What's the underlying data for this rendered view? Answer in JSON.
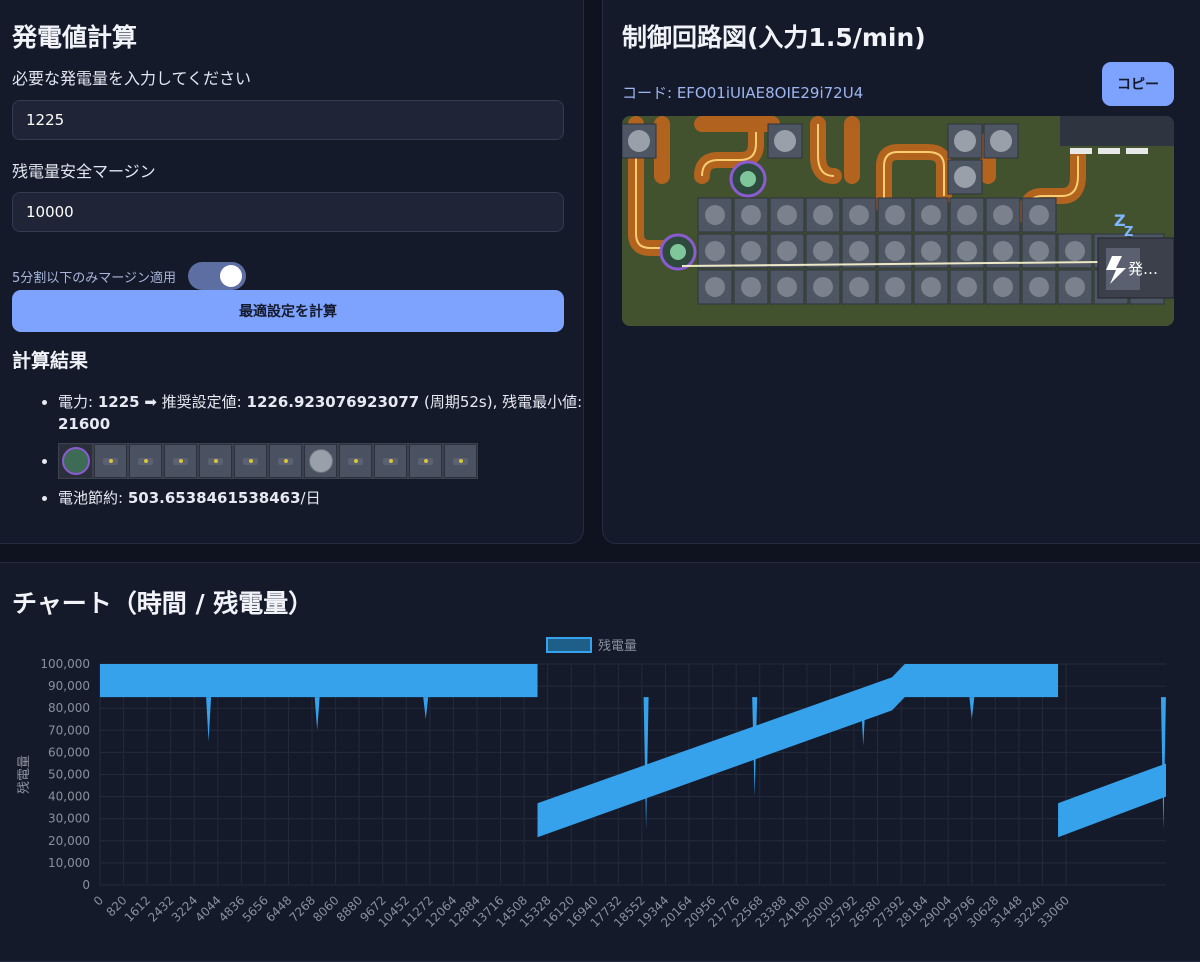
{
  "calc": {
    "title": "発電値計算",
    "power_label": "必要な発電量を入力してください",
    "power_value": "1225",
    "margin_label": "残電量安全マージン",
    "margin_value": "10000",
    "toggle_label": "5分割以下のみマージン適用",
    "toggle_on": true,
    "calc_button": "最適設定を計算",
    "results_title": "計算結果",
    "result1": {
      "prefix": "電力: ",
      "power": "1225",
      "arrow": " ➡ 推奨設定値: ",
      "setting": "1226.923076923077",
      "period": " (周期52s), 残電最小値: ",
      "min": "21600"
    },
    "result3": {
      "prefix": "電池節約: ",
      "value": "503.6538461538463",
      "suffix": "/日"
    },
    "strip": [
      "coin",
      "battery",
      "battery",
      "battery",
      "battery",
      "battery",
      "battery",
      "fan",
      "battery",
      "battery",
      "battery",
      "battery"
    ]
  },
  "circuit": {
    "title": "制御回路図(入力1.5/min)",
    "code_label": "コード: ",
    "code": "EFO01iUIAE8OIE29i72U4",
    "copy_button": "コピー",
    "node_label": "発…"
  },
  "chart_section": {
    "title": "チャート（時間 / 残電量）"
  },
  "chart_data": {
    "type": "area",
    "legend": "残電量",
    "legend_position": "top",
    "ylabel": "残電量",
    "ylim": [
      0,
      100000
    ],
    "y_ticks": [
      "0",
      "10,000",
      "20,000",
      "30,000",
      "40,000",
      "50,000",
      "60,000",
      "70,000",
      "80,000",
      "90,000",
      "100,000"
    ],
    "x_ticks": [
      "0",
      "820",
      "1612",
      "2432",
      "3224",
      "4044",
      "4836",
      "5656",
      "6448",
      "7268",
      "8060",
      "8880",
      "9672",
      "10452",
      "11272",
      "12064",
      "12884",
      "13716",
      "14508",
      "15328",
      "16120",
      "16940",
      "17732",
      "18552",
      "19344",
      "20164",
      "20956",
      "21776",
      "22568",
      "23388",
      "24180",
      "25000",
      "25792",
      "26580",
      "27392",
      "28184",
      "29004",
      "29796",
      "30628",
      "31448",
      "32240",
      "33060"
    ],
    "x_max": 33380,
    "colors": {
      "fill": "#36a2eb",
      "legend_fill": "#1e5f8a",
      "grid": "#232a3a",
      "tick": "#8a8f9c"
    },
    "band_upper": [
      [
        0,
        100000
      ],
      [
        3400,
        100000
      ],
      [
        13700,
        100000
      ],
      [
        13700,
        37000
      ],
      [
        24800,
        94000
      ],
      [
        25200,
        100000
      ],
      [
        30000,
        100000
      ],
      [
        30000,
        37000
      ],
      [
        33380,
        55000
      ]
    ],
    "band_lower": [
      [
        0,
        85000
      ],
      [
        3400,
        85000
      ],
      [
        13700,
        85000
      ],
      [
        13700,
        21600
      ],
      [
        24800,
        79000
      ],
      [
        25200,
        85000
      ],
      [
        30000,
        85000
      ],
      [
        30000,
        21600
      ],
      [
        33380,
        40000
      ]
    ],
    "spikes": [
      [
        3400,
        65000
      ],
      [
        6800,
        70000
      ],
      [
        10200,
        75000
      ],
      [
        17100,
        25000
      ],
      [
        20500,
        40000
      ],
      [
        23900,
        63000
      ],
      [
        27300,
        75000
      ],
      [
        33300,
        25000
      ]
    ]
  }
}
